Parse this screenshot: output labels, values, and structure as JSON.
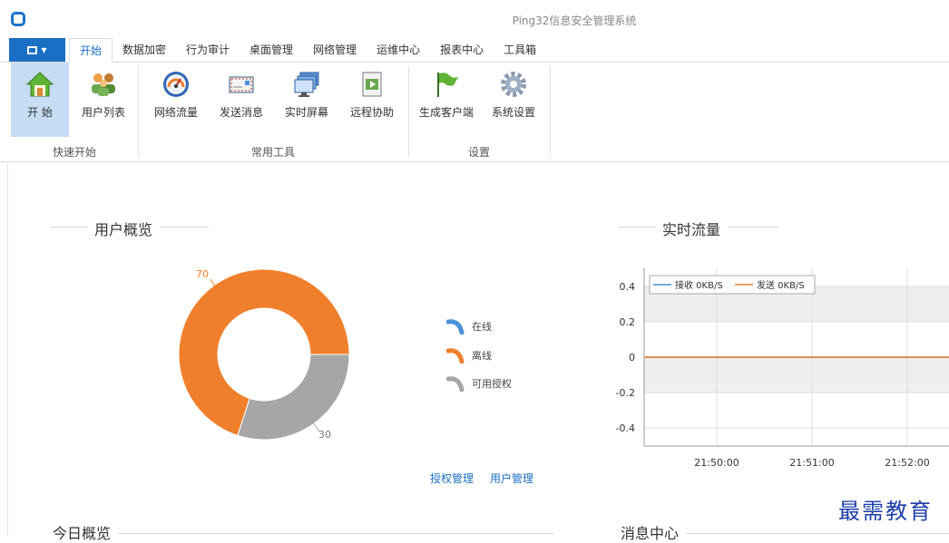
{
  "window": {
    "title": "Ping32信息安全管理系统"
  },
  "menubar": {
    "tabs": [
      {
        "label": "开始",
        "active": true
      },
      {
        "label": "数据加密"
      },
      {
        "label": "行为审计"
      },
      {
        "label": "桌面管理"
      },
      {
        "label": "网络管理"
      },
      {
        "label": "运维中心"
      },
      {
        "label": "报表中心"
      },
      {
        "label": "工具箱"
      }
    ]
  },
  "ribbon": {
    "buttons": [
      {
        "label": "开 始",
        "icon": "home-icon"
      },
      {
        "label": "用户列表",
        "icon": "users-icon"
      },
      {
        "label": "网络流量",
        "icon": "speedometer-icon"
      },
      {
        "label": "发送消息",
        "icon": "envelope-icon"
      },
      {
        "label": "实时屏幕",
        "icon": "monitor-icon"
      },
      {
        "label": "远程协助",
        "icon": "remote-assist-icon"
      },
      {
        "label": "生成客户端",
        "icon": "flag-icon"
      },
      {
        "label": "系统设置",
        "icon": "gear-icon"
      }
    ],
    "groups": [
      "快速开始",
      "常用工具",
      "设置"
    ]
  },
  "user_overview": {
    "title": "用户概览",
    "links": [
      "授权管理",
      "用户管理"
    ]
  },
  "realtime_traffic": {
    "title": "实时流量"
  },
  "today_overview": {
    "title": "今日概览"
  },
  "message_center": {
    "title": "消息中心"
  },
  "watermark": "最需教育",
  "colors": {
    "accent": "#1a6fc4",
    "offline": "#f07f2b",
    "available": "#a6a6a6",
    "online": "#4a90d9"
  },
  "chart_data": [
    {
      "type": "pie",
      "variant": "donut",
      "categories": [
        "在线",
        "离线",
        "可用授权"
      ],
      "values": [
        0,
        70,
        30
      ],
      "data_labels": [
        "",
        "70",
        "30"
      ],
      "legend": "right"
    },
    {
      "type": "line",
      "x": [
        "21:50:00",
        "21:51:00",
        "21:52:00"
      ],
      "series": [
        {
          "name": "接收 0KB/S",
          "values": [
            0,
            0,
            0
          ],
          "color": "#4a90d9"
        },
        {
          "name": "发送 0KB/S",
          "values": [
            0,
            0,
            0
          ],
          "color": "#f07f2b"
        }
      ],
      "yticks": [
        "0.4",
        "0.2",
        "0",
        "-0.2",
        "-0.4"
      ],
      "ylim": [
        -0.4,
        0.4
      ],
      "grid": true,
      "legend": "top-left"
    }
  ]
}
